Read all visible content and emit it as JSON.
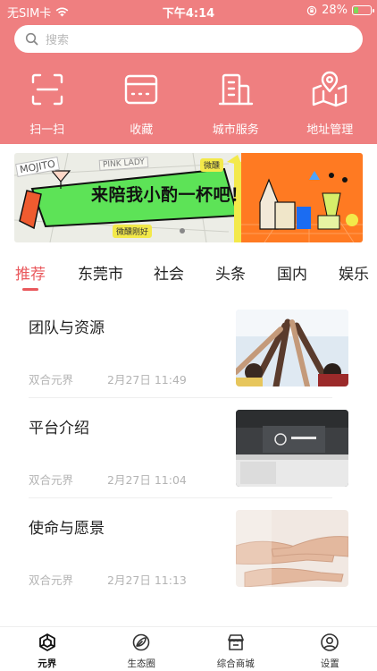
{
  "status_bar": {
    "carrier": "无SIM卡",
    "time": "下午4:14",
    "battery": "28%",
    "battery_level": 0.28
  },
  "search": {
    "placeholder": "搜索"
  },
  "quick_actions": [
    {
      "label": "扫一扫",
      "icon": "scan-icon"
    },
    {
      "label": "收藏",
      "icon": "favorites-icon"
    },
    {
      "label": "城市服务",
      "icon": "city-building-icon"
    },
    {
      "label": "地址管理",
      "icon": "map-location-icon"
    }
  ],
  "banner": {
    "headline": "来陪我小酌一杯吧！",
    "tag1": "微醺刚好",
    "tag2": "微醺",
    "deco1": "MOJITO",
    "deco2": "PINK LADY"
  },
  "tabs": [
    "推荐",
    "东莞市",
    "社会",
    "头条",
    "国内",
    "娱乐"
  ],
  "active_tab": 0,
  "news": [
    {
      "title": "团队与资源",
      "source": "双合元界",
      "time": "2月27日 11:49",
      "thumb": "team-high-five"
    },
    {
      "title": "平台介绍",
      "source": "双合元界",
      "time": "2月27日 11:04",
      "thumb": "office-reception"
    },
    {
      "title": "使命与愿景",
      "source": "双合元界",
      "time": "2月27日 11:13",
      "thumb": "stacked-hands"
    }
  ],
  "bottom_nav": [
    {
      "label": "元界",
      "icon": "metaverse-icon",
      "active": true
    },
    {
      "label": "生态圈",
      "icon": "ecosphere-icon",
      "active": false
    },
    {
      "label": "综合商城",
      "icon": "mall-icon",
      "active": false
    },
    {
      "label": "设置",
      "icon": "settings-user-icon",
      "active": false
    }
  ],
  "colors": {
    "header_bg": "#ef7f80",
    "accent": "#e9585c",
    "banner_green": "#5de357",
    "banner_orange": "#ff7a22"
  }
}
